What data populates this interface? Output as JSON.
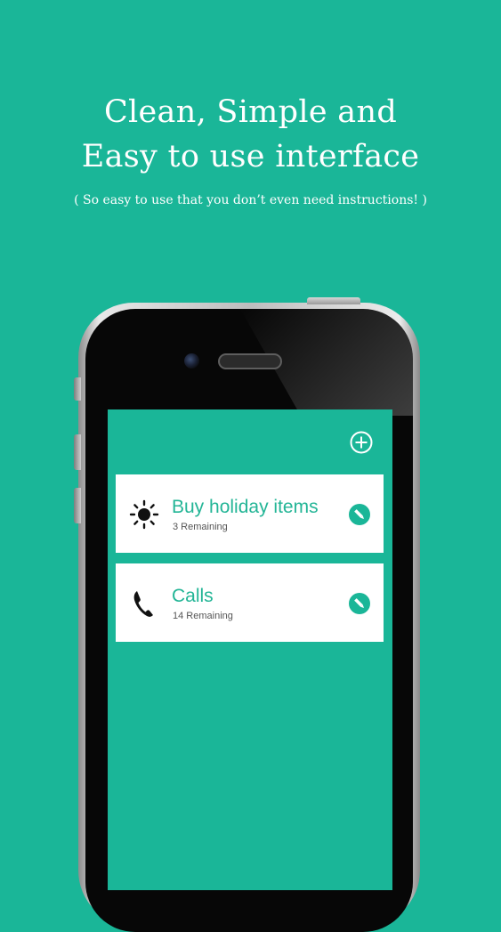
{
  "header": {
    "title_line1": "Clean, Simple and",
    "title_line2": "Easy to use interface",
    "subtitle": "( So easy to use that you don’t even need instructions! )"
  },
  "colors": {
    "background": "#1ab698",
    "accent": "#1ab698",
    "card": "#ffffff",
    "title_text": "#23b596"
  },
  "app": {
    "add_icon": "plus-circle-icon",
    "lists": [
      {
        "title": "Buy holiday items",
        "remaining": "3 Remaining",
        "icon": "sun-icon",
        "edit_icon": "pencil-icon"
      },
      {
        "title": "Calls",
        "remaining": "14 Remaining",
        "icon": "phone-icon",
        "edit_icon": "pencil-icon"
      }
    ]
  }
}
